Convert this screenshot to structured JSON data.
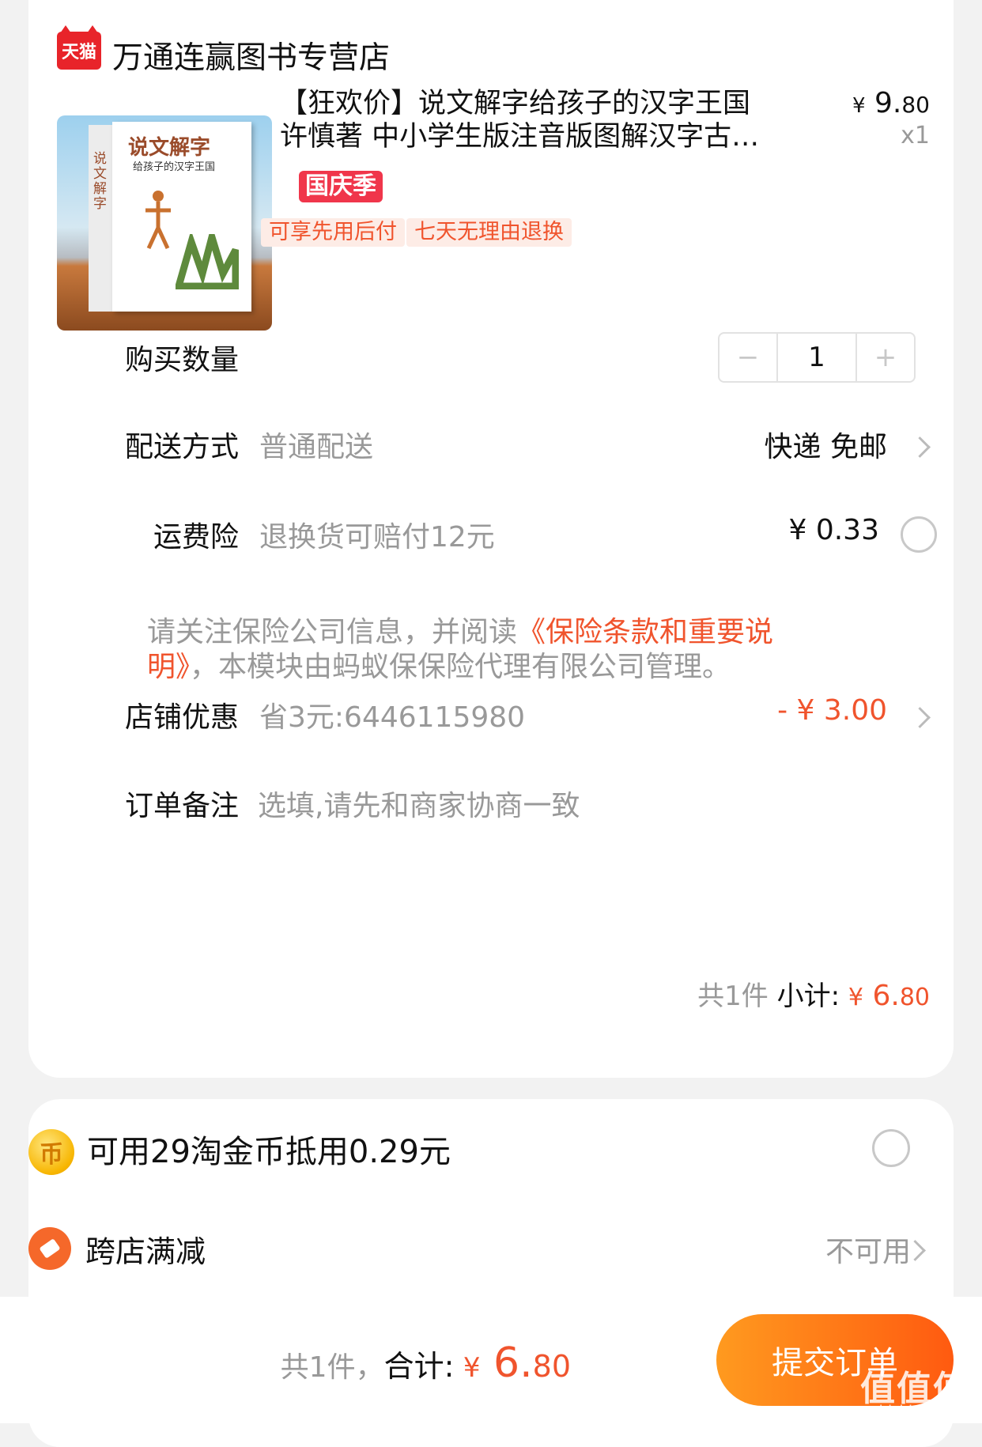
{
  "store": {
    "logo_text": "天猫",
    "name": "万通连赢图书专营店"
  },
  "product": {
    "title_line1": "【狂欢价】说文解字给孩子的汉字王国",
    "title_line2": "许慎著 中小学生版注音版图解汉字古…",
    "price_symbol": "¥",
    "price_int": "9.",
    "price_dec": "80",
    "quantity_label": "x1",
    "badge": "国庆季",
    "tags": [
      "可享先用后付",
      "七天无理由退换"
    ],
    "image": {
      "title": "说文解字",
      "subtitle": "给孩子的汉字王国",
      "spine": "说文解字"
    }
  },
  "quantity": {
    "label": "购买数量",
    "value": "1",
    "minus": "−",
    "plus": "+"
  },
  "delivery": {
    "label": "配送方式",
    "hint": "普通配送",
    "value": "快递 免邮"
  },
  "shipping_insurance": {
    "label": "运费险",
    "hint": "退换货可赔付12元",
    "value": "¥ 0.33"
  },
  "notice": {
    "prefix": "请关注保险公司信息，并阅读",
    "link": "《保险条款和重要说明》",
    "suffix": "，本模块由蚂蚁保保险代理有限公司管理。"
  },
  "store_discount": {
    "label": "店铺优惠",
    "hint": "省3元:6446115980",
    "value": "- ¥ 3.00"
  },
  "order_note": {
    "label": "订单备注",
    "placeholder": "选填,请先和商家协商一致"
  },
  "subtotal": {
    "count_text": "共1件",
    "label": "小计:",
    "symbol": "¥",
    "int": "6.",
    "dec": "80"
  },
  "coins": {
    "icon_char": "币",
    "text": "可用29淘金币抵用0.29元"
  },
  "cross_store": {
    "label": "跨店满减",
    "value": "不可用"
  },
  "footer": {
    "count_text": "共1件，",
    "total_label": "合计:",
    "symbol": "¥",
    "int": "6.",
    "dec": "80",
    "submit": "提交订单",
    "watermark": "值值值",
    "watermark_url": "zhizhizhi.com"
  },
  "colors": {
    "accent": "#f0542d",
    "badge": "#f0364b",
    "submit_from": "#ff9a1f",
    "submit_to": "#ff5a10"
  }
}
